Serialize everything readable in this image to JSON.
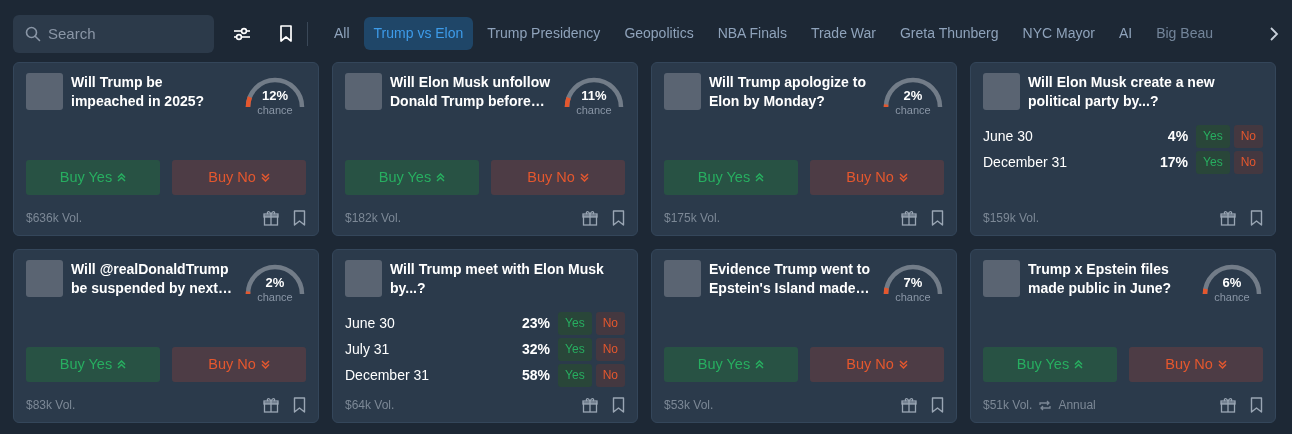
{
  "search": {
    "placeholder": "Search"
  },
  "tabs": [
    {
      "label": "All",
      "selected": false
    },
    {
      "label": "Trump vs Elon",
      "selected": true
    },
    {
      "label": "Trump Presidency",
      "selected": false
    },
    {
      "label": "Geopolitics",
      "selected": false
    },
    {
      "label": "NBA Finals",
      "selected": false
    },
    {
      "label": "Trade War",
      "selected": false
    },
    {
      "label": "Greta Thunberg",
      "selected": false
    },
    {
      "label": "NYC Mayor",
      "selected": false
    },
    {
      "label": "AI",
      "selected": false
    },
    {
      "label": "Big Beau",
      "selected": false
    }
  ],
  "markets": [
    {
      "kind": "binary",
      "title": "Will Trump be impeached in 2025?",
      "chance": "12%",
      "chance_label": "chance",
      "level": 0.12,
      "buy_yes": "Buy Yes",
      "buy_no": "Buy No",
      "volume": "$636k Vol."
    },
    {
      "kind": "binary",
      "title": "Will Elon Musk unfollow Donald Trump before…",
      "chance": "11%",
      "chance_label": "chance",
      "level": 0.11,
      "buy_yes": "Buy Yes",
      "buy_no": "Buy No",
      "volume": "$182k Vol."
    },
    {
      "kind": "binary",
      "title": "Will Trump apologize to Elon by Monday?",
      "chance": "2%",
      "chance_label": "chance",
      "level": 0.02,
      "buy_yes": "Buy Yes",
      "buy_no": "Buy No",
      "volume": "$175k Vol."
    },
    {
      "kind": "multi",
      "title": "Will Elon Musk create a new political party by...?",
      "outcomes": [
        {
          "label": "June 30",
          "chance": "4%",
          "yes": "Yes",
          "no": "No"
        },
        {
          "label": "December 31",
          "chance": "17%",
          "yes": "Yes",
          "no": "No"
        }
      ],
      "volume": "$159k Vol."
    },
    {
      "kind": "binary",
      "title": "Will @realDonaldTrump be suspended by next…",
      "chance": "2%",
      "chance_label": "chance",
      "level": 0.02,
      "buy_yes": "Buy Yes",
      "buy_no": "Buy No",
      "volume": "$83k Vol."
    },
    {
      "kind": "multi",
      "title": "Will Trump meet with Elon Musk by...?",
      "outcomes": [
        {
          "label": "June 30",
          "chance": "23%",
          "yes": "Yes",
          "no": "No"
        },
        {
          "label": "July 31",
          "chance": "32%",
          "yes": "Yes",
          "no": "No"
        },
        {
          "label": "December 31",
          "chance": "58%",
          "yes": "Yes",
          "no": "No"
        }
      ],
      "volume": "$64k Vol."
    },
    {
      "kind": "binary",
      "title": "Evidence Trump went to Epstein's Island made…",
      "chance": "7%",
      "chance_label": "chance",
      "level": 0.07,
      "buy_yes": "Buy Yes",
      "buy_no": "Buy No",
      "volume": "$53k Vol."
    },
    {
      "kind": "binary",
      "title": "Trump x Epstein files made public in June?",
      "chance": "6%",
      "chance_label": "chance",
      "level": 0.06,
      "buy_yes": "Buy Yes",
      "buy_no": "Buy No",
      "volume": "$51k Vol.",
      "recurrence": "Annual"
    }
  ]
}
